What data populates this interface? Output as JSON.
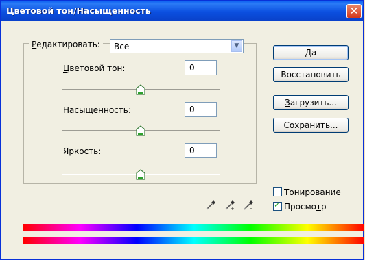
{
  "window": {
    "title": "Цветовой тон/Насыщенность",
    "close_glyph": "✕"
  },
  "edit": {
    "label": "Редактировать:",
    "mnemonic": "Р",
    "rest": "едактировать:",
    "value": "Все"
  },
  "sliders": [
    {
      "label": "Цветовой тон:",
      "mnemonic": "Ц",
      "rest": "ветовой тон:",
      "value": "0",
      "level_percent": 50
    },
    {
      "label": "Насыщенность:",
      "mnemonic": "Н",
      "rest": "асыщенность:",
      "value": "0",
      "level_percent": 50
    },
    {
      "label": "Яркость:",
      "mnemonic": "Я",
      "rest": "ркость:",
      "value": "0",
      "level_percent": 50
    }
  ],
  "buttons": {
    "ok": {
      "label": "Да",
      "mnemonic": "Д",
      "rest": "а"
    },
    "reset": {
      "label": "Восстановить"
    },
    "load": {
      "label": "Загрузить...",
      "mnemonic": "З",
      "rest": "агрузить..."
    },
    "save": {
      "label": "Сохранить...",
      "pre": "Со",
      "mnemonic": "х",
      "rest": "ранить..."
    }
  },
  "checkboxes": {
    "colorize": {
      "label": "Тонирование",
      "pre": "Т",
      "mnemonic": "о",
      "rest": "нирование",
      "checked": false
    },
    "preview": {
      "label": "Просмотр",
      "pre": "Просмо",
      "mnemonic": "т",
      "rest": "р",
      "checked": true
    }
  },
  "icons": [
    "eyedropper-icon",
    "eyedropper-plus-icon",
    "eyedropper-minus-icon",
    "dropdown-arrow-icon",
    "slider-thumb-icon",
    "checkmark-icon",
    "close-icon"
  ],
  "colors": {
    "title_bar": "#0a5ef0",
    "dialog_bg": "#f1efe2",
    "border": "#0831d9",
    "desktop": "#f6e3c0",
    "checkmark": "#21a121"
  }
}
